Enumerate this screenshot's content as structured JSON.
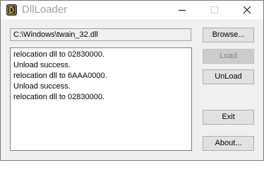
{
  "window": {
    "title": "DllLoader",
    "icon": "dll-loader-app-icon",
    "controls": {
      "minimize_icon": "minimize-icon",
      "maximize_icon": "maximize-icon",
      "close_icon": "close-icon"
    }
  },
  "path_field": {
    "value": "C:\\Windows\\twain_32.dll"
  },
  "log": {
    "lines": [
      "relocation dll to 02830000.",
      "Unload success.",
      "relocation dll to 6AAA0000.",
      "Unload success.",
      "relocation dll to 02830000."
    ]
  },
  "buttons": {
    "browse": {
      "label": "Browse...",
      "enabled": true
    },
    "load": {
      "label": "Load",
      "enabled": false
    },
    "unload": {
      "label": "UnLoad",
      "enabled": true
    },
    "exit": {
      "label": "Exit",
      "enabled": true
    },
    "about": {
      "label": "About...",
      "enabled": true
    }
  },
  "colors": {
    "window_bg": "#f0f0f0",
    "title_text": "#a0a0a0",
    "button_bg": "#e1e1e1",
    "button_border": "#adadad",
    "disabled_text": "#838383",
    "app_icon_dark": "#2b2b2b",
    "app_icon_accent": "#d8c25a"
  }
}
